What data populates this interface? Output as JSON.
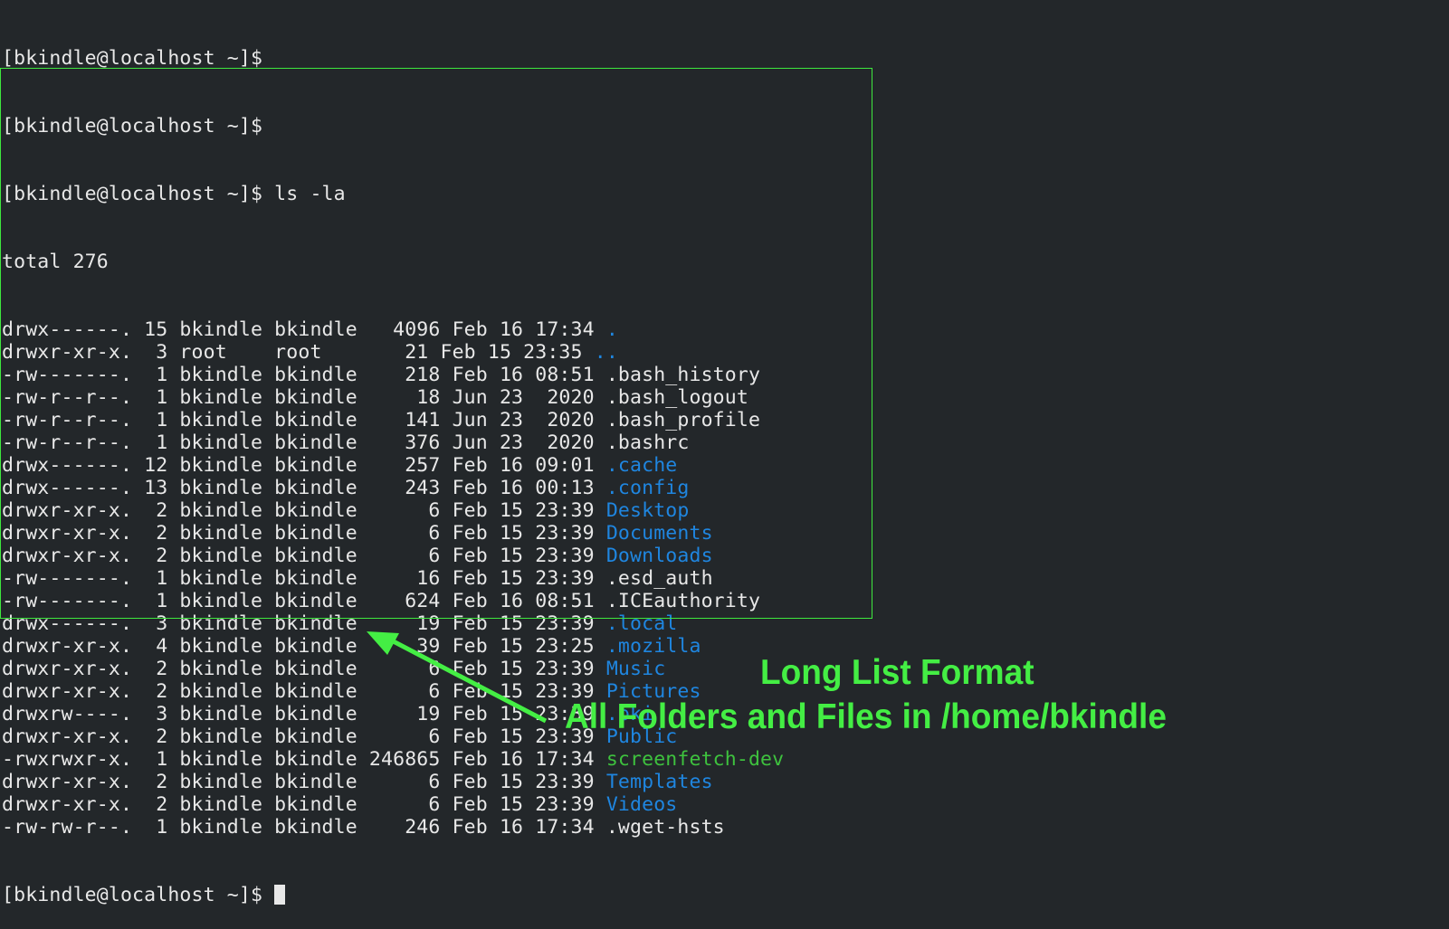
{
  "terminal": {
    "prompt": "[bkindle@localhost ~]$",
    "history": [
      {
        "prompt": "[bkindle@localhost ~]$",
        "command": ""
      },
      {
        "prompt": "[bkindle@localhost ~]$",
        "command": ""
      },
      {
        "prompt": "[bkindle@localhost ~]$",
        "command": " ls -la"
      }
    ],
    "total_line": "total 276",
    "entries": [
      {
        "prefix": "drwx------. 15 bkindle bkindle   4096 Feb 16 17:34 ",
        "name": ".",
        "type": "dir"
      },
      {
        "prefix": "drwxr-xr-x.  3 root    root       21 Feb 15 23:35 ",
        "name": "..",
        "type": "dir"
      },
      {
        "prefix": "-rw-------.  1 bkindle bkindle    218 Feb 16 08:51 ",
        "name": ".bash_history",
        "type": "file"
      },
      {
        "prefix": "-rw-r--r--.  1 bkindle bkindle     18 Jun 23  2020 ",
        "name": ".bash_logout",
        "type": "file"
      },
      {
        "prefix": "-rw-r--r--.  1 bkindle bkindle    141 Jun 23  2020 ",
        "name": ".bash_profile",
        "type": "file"
      },
      {
        "prefix": "-rw-r--r--.  1 bkindle bkindle    376 Jun 23  2020 ",
        "name": ".bashrc",
        "type": "file"
      },
      {
        "prefix": "drwx------. 12 bkindle bkindle    257 Feb 16 09:01 ",
        "name": ".cache",
        "type": "dir"
      },
      {
        "prefix": "drwx------. 13 bkindle bkindle    243 Feb 16 00:13 ",
        "name": ".config",
        "type": "dir"
      },
      {
        "prefix": "drwxr-xr-x.  2 bkindle bkindle      6 Feb 15 23:39 ",
        "name": "Desktop",
        "type": "dir"
      },
      {
        "prefix": "drwxr-xr-x.  2 bkindle bkindle      6 Feb 15 23:39 ",
        "name": "Documents",
        "type": "dir"
      },
      {
        "prefix": "drwxr-xr-x.  2 bkindle bkindle      6 Feb 15 23:39 ",
        "name": "Downloads",
        "type": "dir"
      },
      {
        "prefix": "-rw-------.  1 bkindle bkindle     16 Feb 15 23:39 ",
        "name": ".esd_auth",
        "type": "file"
      },
      {
        "prefix": "-rw-------.  1 bkindle bkindle    624 Feb 16 08:51 ",
        "name": ".ICEauthority",
        "type": "file"
      },
      {
        "prefix": "drwx------.  3 bkindle bkindle     19 Feb 15 23:39 ",
        "name": ".local",
        "type": "dir"
      },
      {
        "prefix": "drwxr-xr-x.  4 bkindle bkindle     39 Feb 15 23:25 ",
        "name": ".mozilla",
        "type": "dir"
      },
      {
        "prefix": "drwxr-xr-x.  2 bkindle bkindle      6 Feb 15 23:39 ",
        "name": "Music",
        "type": "dir"
      },
      {
        "prefix": "drwxr-xr-x.  2 bkindle bkindle      6 Feb 15 23:39 ",
        "name": "Pictures",
        "type": "dir"
      },
      {
        "prefix": "drwxrw----.  3 bkindle bkindle     19 Feb 15 23:39 ",
        "name": ".pki",
        "type": "dir"
      },
      {
        "prefix": "drwxr-xr-x.  2 bkindle bkindle      6 Feb 15 23:39 ",
        "name": "Public",
        "type": "dir"
      },
      {
        "prefix": "-rwxrwxr-x.  1 bkindle bkindle 246865 Feb 16 17:34 ",
        "name": "screenfetch-dev",
        "type": "exe"
      },
      {
        "prefix": "drwxr-xr-x.  2 bkindle bkindle      6 Feb 15 23:39 ",
        "name": "Templates",
        "type": "dir"
      },
      {
        "prefix": "drwxr-xr-x.  2 bkindle bkindle      6 Feb 15 23:39 ",
        "name": "Videos",
        "type": "dir"
      },
      {
        "prefix": "-rw-rw-r--.  1 bkindle bkindle    246 Feb 16 17:34 ",
        "name": ".wget-hsts",
        "type": "file"
      }
    ],
    "final_prompt": "[bkindle@localhost ~]$ "
  },
  "annotation": {
    "line1": "Long List Format",
    "line2": "All Folders and Files in /home/bkindle",
    "color": "#44ee44"
  },
  "colors": {
    "background": "#23272a",
    "text": "#e8e8e8",
    "directory": "#1f86e0",
    "executable": "#3ec23e"
  }
}
